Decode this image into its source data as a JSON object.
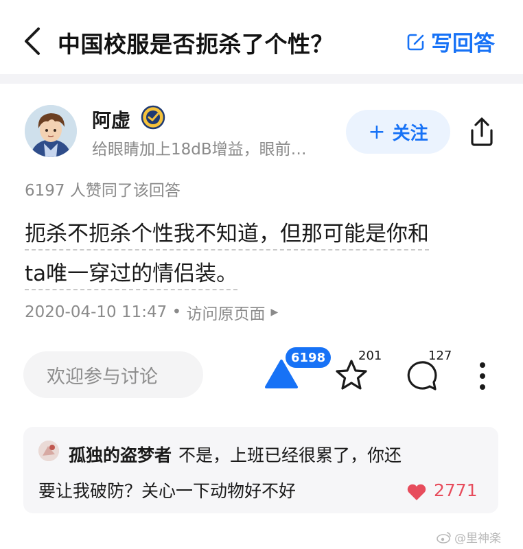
{
  "header": {
    "question_title": "中国校服是否扼杀了个性？",
    "write_answer_label": "写回答"
  },
  "author": {
    "name": "阿虚",
    "bio": "给眼睛加上18dB增益，眼前…",
    "follow_label": "关注"
  },
  "answer": {
    "likes_text": "6197 人赞同了该回答",
    "content_lines": [
      "扼杀不扼杀个性我不知道，但那可能是你和",
      "ta唯一穿过的情侣装。"
    ],
    "timestamp": "2020-04-10 11:47",
    "visit_original": "访问原页面"
  },
  "actions": {
    "comment_placeholder": "欢迎参与讨论",
    "upvote_count": "6198",
    "favorite_count": "201",
    "comment_count": "127"
  },
  "featured_comment": {
    "username": "孤独的盗梦者",
    "text_line1": "不是，上班已经很累了，你还",
    "text_line2": "要让我破防？关心一下动物好不好",
    "likes": "2771"
  },
  "watermark": {
    "text": "@里神楽"
  },
  "colors": {
    "accent": "#1772f6",
    "muted_text": "#8a8a8a",
    "like_red": "#e74c5c"
  },
  "icons": [
    "back-arrow-icon",
    "pen-icon",
    "verified-badge-icon",
    "share-icon",
    "upvote-triangle-icon",
    "star-icon",
    "comment-bubble-icon",
    "more-dots-icon",
    "heart-icon",
    "weibo-icon"
  ]
}
